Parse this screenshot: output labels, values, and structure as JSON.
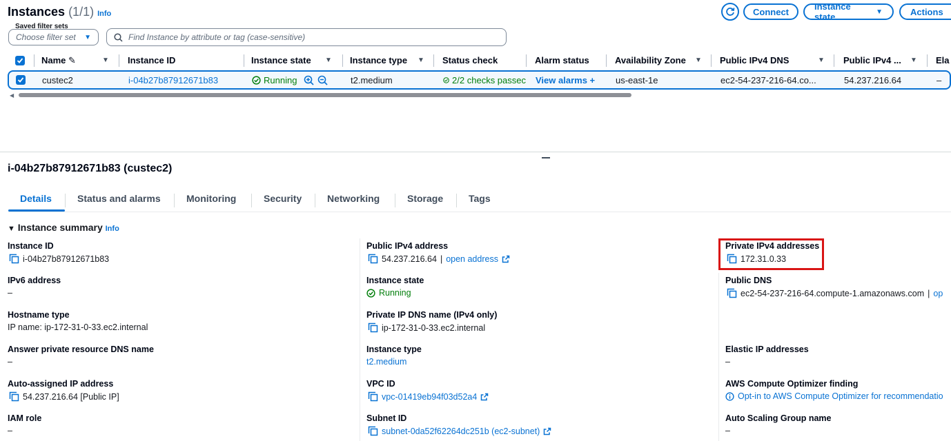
{
  "header": {
    "title": "Instances",
    "count": "(1/1)",
    "info": "Info",
    "connect": "Connect",
    "instance_state": "Instance state",
    "actions": "Actions",
    "saved_filter_label": "Saved filter sets",
    "saved_filter_placeholder": "Choose filter set",
    "search_placeholder": "Find Instance by attribute or tag (case-sensitive)"
  },
  "table": {
    "columns": [
      "Name",
      "Instance ID",
      "Instance state",
      "Instance type",
      "Status check",
      "Alarm status",
      "Availability Zone",
      "Public IPv4 DNS",
      "Public IPv4 ...",
      "Ela"
    ],
    "row": {
      "name": "custec2",
      "instance_id": "i-04b27b87912671b83",
      "state": "Running",
      "type": "t2.medium",
      "status_check": "2/2 checks passec",
      "alarm": "View alarms",
      "az": "us-east-1e",
      "dns": "ec2-54-237-216-64.co...",
      "ipv4": "54.237.216.64",
      "elastic": "–"
    }
  },
  "detail": {
    "title": "i-04b27b87912671b83 (custec2)",
    "tabs": [
      "Details",
      "Status and alarms",
      "Monitoring",
      "Security",
      "Networking",
      "Storage",
      "Tags"
    ],
    "summary_title": "Instance summary",
    "summary_info": "Info",
    "col1": [
      {
        "label": "Instance ID",
        "value": "i-04b27b87912671b83"
      },
      {
        "label": "IPv6 address",
        "value": "–"
      },
      {
        "label": "Hostname type",
        "value": "IP name: ip-172-31-0-33.ec2.internal"
      },
      {
        "label": "Answer private resource DNS name",
        "value": "–"
      },
      {
        "label": "Auto-assigned IP address",
        "value": "54.237.216.64 [Public IP]"
      },
      {
        "label": "IAM role",
        "value": "–"
      }
    ],
    "col2": [
      {
        "label": "Public IPv4 address",
        "value": "54.237.216.64",
        "link": "open address"
      },
      {
        "label": "Instance state",
        "value": "Running"
      },
      {
        "label": "Private IP DNS name (IPv4 only)",
        "value": "ip-172-31-0-33.ec2.internal"
      },
      {
        "label": "Instance type",
        "value": "t2.medium"
      },
      {
        "label": "VPC ID",
        "value": "vpc-01419eb94f03d52a4"
      },
      {
        "label": "Subnet ID",
        "value": "subnet-0da52f62264dc251b (ec2-subnet)"
      }
    ],
    "col3": [
      {
        "label": "Private IPv4 addresses",
        "value": "172.31.0.33"
      },
      {
        "label": "Public DNS",
        "value": "ec2-54-237-216-64.compute-1.amazonaws.com",
        "link": "op"
      },
      {
        "label": "Elastic IP addresses",
        "value": "–"
      },
      {
        "label": "AWS Compute Optimizer finding",
        "value": "Opt-in to AWS Compute Optimizer for recommendatio"
      },
      {
        "label": "Auto Scaling Group name",
        "value": "–"
      }
    ]
  },
  "colors": {
    "accent": "#0972d3",
    "success": "#037f0c",
    "highlight": "#d91515"
  }
}
